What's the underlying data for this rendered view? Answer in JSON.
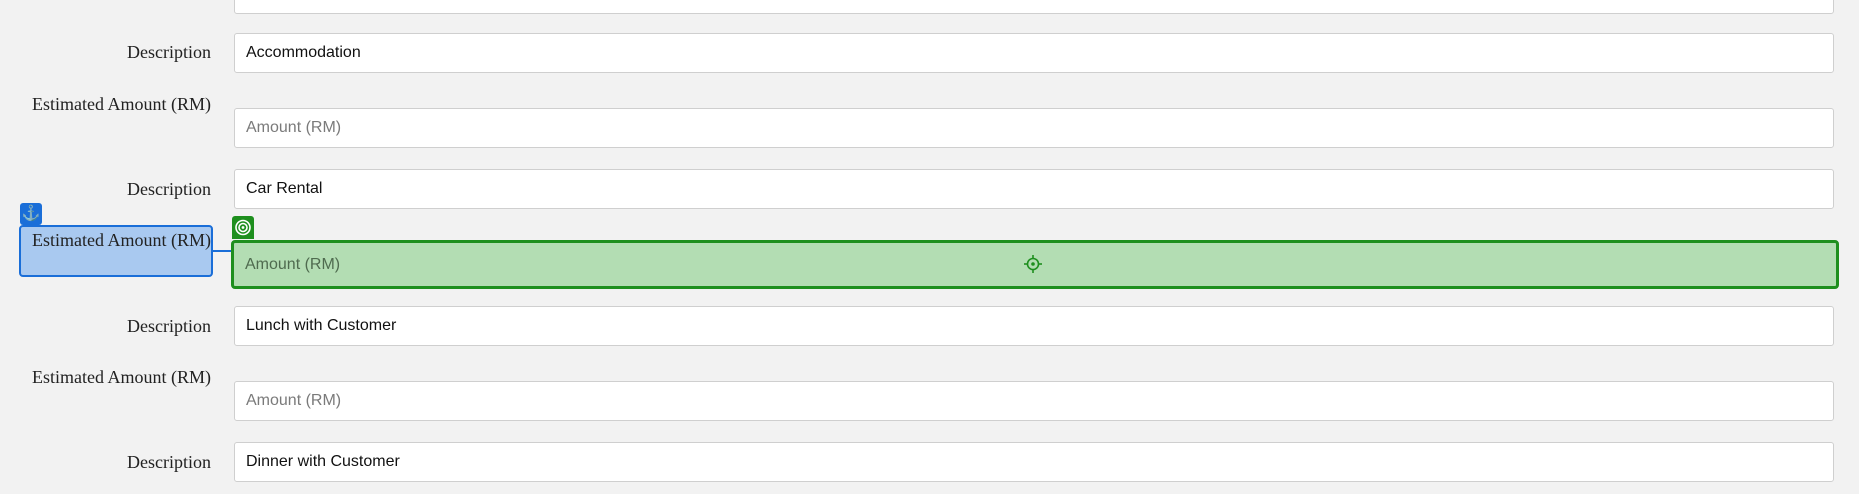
{
  "form": {
    "rows": [
      {
        "label": "Description",
        "value": "Accommodation"
      },
      {
        "label": "Estimated Amount (RM)",
        "placeholder": "Amount (RM)"
      },
      {
        "label": "Description",
        "value": "Car Rental"
      },
      {
        "label": "Estimated Amount (RM)",
        "placeholder": "Amount (RM)"
      },
      {
        "label": "Description",
        "value": "Lunch with Customer"
      },
      {
        "label": "Estimated Amount (RM)",
        "placeholder": "Amount (RM)"
      },
      {
        "label": "Description",
        "value": "Dinner with Customer"
      }
    ]
  },
  "overlay": {
    "anchor_icon": "anchor-icon",
    "target_icon": "target-icon",
    "crosshair_icon": "crosshair-icon",
    "anchor_color": "#1a6ed8",
    "target_color": "#1e8f1e"
  }
}
